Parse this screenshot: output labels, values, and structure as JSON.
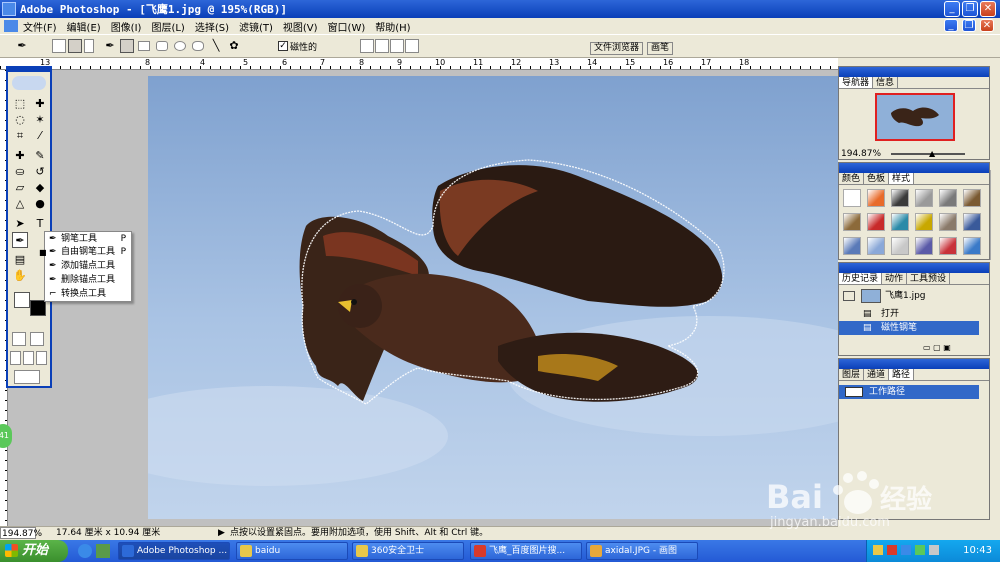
{
  "window": {
    "title": "Adobe Photoshop - [飞鹰1.jpg @ 195%(RGB)]",
    "controls": [
      "_",
      "❐",
      "✕"
    ]
  },
  "menubar": {
    "items": [
      "文件(F)",
      "编辑(E)",
      "图像(I)",
      "图层(L)",
      "选择(S)",
      "滤镜(T)",
      "视图(V)",
      "窗口(W)",
      "帮助(H)"
    ]
  },
  "options": {
    "magnetic_label": "磁性的",
    "magnetic_checked": true,
    "tabs": [
      "文件浏览器",
      "画笔"
    ]
  },
  "rulers": {
    "top_numbers": [
      "13",
      "8",
      "4",
      "5",
      "6",
      "7",
      "8",
      "9",
      "10",
      "11",
      "12",
      "13",
      "14",
      "15",
      "16",
      "17",
      "18"
    ],
    "left_numbers": [
      "1",
      "2",
      "3",
      "4",
      "5",
      "6",
      "7",
      "8",
      "9"
    ]
  },
  "pen_flyout": {
    "items": [
      {
        "label": "钢笔工具",
        "shortcut": "P"
      },
      {
        "label": "自由钢笔工具",
        "shortcut": "P"
      },
      {
        "label": "添加锚点工具",
        "shortcut": ""
      },
      {
        "label": "删除锚点工具",
        "shortcut": ""
      },
      {
        "label": "转换点工具",
        "shortcut": ""
      }
    ]
  },
  "navigator": {
    "tabs": [
      "导航器",
      "信息"
    ],
    "zoom": "194.87%"
  },
  "color_panel": {
    "tabs": [
      "颜色",
      "色板",
      "样式"
    ],
    "swatches": [
      "#ffffff",
      "#e86b2a",
      "#3a3a3a",
      "#9a9a9a",
      "#7a7a7a",
      "#7a5a32",
      "#8c6a3a",
      "#c82a2a",
      "#2a8aa8",
      "#c8a800",
      "#8a7a6a",
      "#3a5a9a",
      "#5a7ab8",
      "#8aa8d8",
      "#c8c8c8",
      "#5a5aa8",
      "#c8323a",
      "#3a7ac8"
    ]
  },
  "history": {
    "tabs": [
      "历史记录",
      "动作",
      "工具预设"
    ],
    "snapshot": "飞鹰1.jpg",
    "steps": [
      "打开",
      "磁性钢笔"
    ]
  },
  "paths": {
    "tabs": [
      "图层",
      "通道",
      "路径"
    ],
    "items": [
      "工作路径"
    ]
  },
  "status": {
    "zoom": "194.87%",
    "doc_size": "17.64 厘米 x 10.94 厘米",
    "hint": "点按以设置紧固点。要用附加选项，使用 Shift、Alt 和 Ctrl 键。"
  },
  "taskbar": {
    "start": "开始",
    "tasks": [
      {
        "label": "Adobe Photoshop ...",
        "color": "#2d6ad8"
      },
      {
        "label": "baidu",
        "color": "#e8c84a"
      },
      {
        "label": "360安全卫士",
        "color": "#e8c84a"
      },
      {
        "label": "飞鹰_百度图片搜...",
        "color": "#d83a2a"
      },
      {
        "label": "axidal.JPG - 画图",
        "color": "#e8a83a"
      }
    ],
    "clock": "10:43"
  },
  "watermark": {
    "brand": "Bai",
    "brand2": "经验",
    "url": "jingyan.baidu.com"
  },
  "side_badge": "41"
}
